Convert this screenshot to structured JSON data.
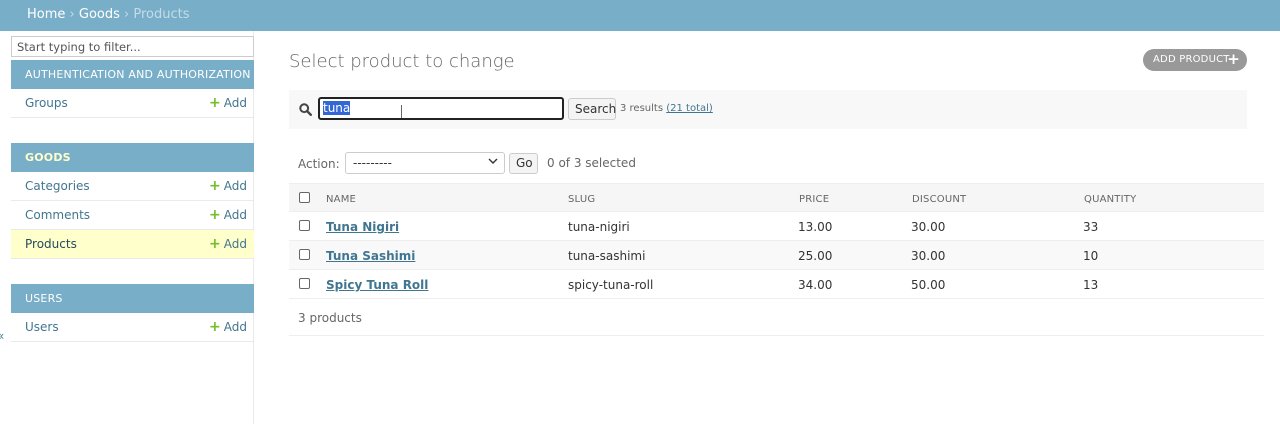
{
  "breadcrumbs": {
    "home": "Home",
    "sep": "›",
    "app": "Goods",
    "current": "Products"
  },
  "sidebar": {
    "filter_placeholder": "Start typing to filter...",
    "add_label": "Add",
    "modules": [
      {
        "caption": "AUTHENTICATION AND AUTHORIZATION",
        "items": [
          {
            "label": "Groups"
          }
        ]
      },
      {
        "caption": "GOODS",
        "items": [
          {
            "label": "Categories"
          },
          {
            "label": "Comments"
          },
          {
            "label": "Products",
            "selected": true
          }
        ]
      },
      {
        "caption": "USERS",
        "items": [
          {
            "label": "Users"
          }
        ]
      }
    ],
    "collapse_glyph": "«"
  },
  "page": {
    "title": "Select product to change",
    "add_button": "ADD PRODUCT",
    "add_icon": "+"
  },
  "search": {
    "value": "tuna",
    "button": "Search",
    "results": "3 results",
    "total": "(21 total)"
  },
  "actions": {
    "label": "Action:",
    "selected": "---------",
    "go": "Go",
    "selection": "0 of 3 selected"
  },
  "table": {
    "headers": [
      "NAME",
      "SLUG",
      "PRICE",
      "DISCOUNT",
      "QUANTITY"
    ],
    "rows": [
      {
        "name": "Tuna Nigiri",
        "slug": "tuna-nigiri",
        "price": "13.00",
        "discount": "30.00",
        "quantity": "33"
      },
      {
        "name": "Tuna Sashimi",
        "slug": "tuna-sashimi",
        "price": "25.00",
        "discount": "30.00",
        "quantity": "10"
      },
      {
        "name": "Spicy Tuna Roll",
        "slug": "spicy-tuna-roll",
        "price": "34.00",
        "discount": "50.00",
        "quantity": "13"
      }
    ]
  },
  "paginator": "3 products",
  "colors": {
    "header": "#79aec8",
    "link": "#417690",
    "selected_row": "#ffffcc",
    "add_plus": "#70bf2b"
  }
}
